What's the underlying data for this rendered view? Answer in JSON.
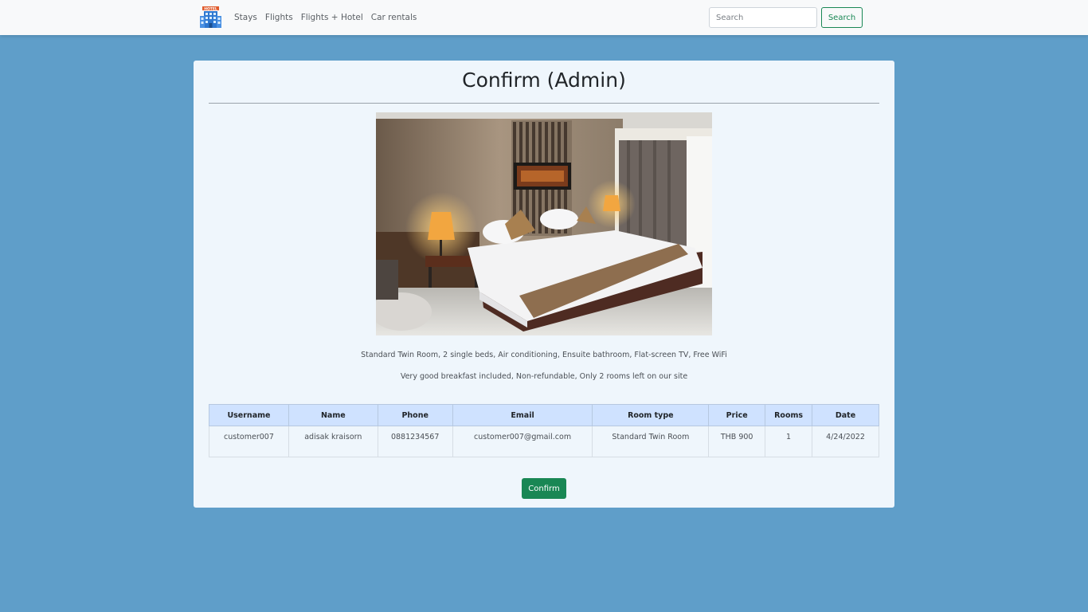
{
  "navbar": {
    "logo_icon": "hotel-building-icon",
    "logo_text": "HOTEL",
    "links": [
      "Stays",
      "Flights",
      "Flights + Hotel",
      "Car rentals"
    ],
    "search_placeholder": "Search",
    "search_button": "Search"
  },
  "page": {
    "title": "Confirm (Admin)",
    "photo_icon": "hotel-room-photo",
    "description_line1": "Standard Twin Room, 2 single beds, Air conditioning, Ensuite bathroom, Flat-screen TV, Free WiFi",
    "description_line2": "Very good breakfast included, Non-refundable, Only 2 rooms left on our site"
  },
  "table": {
    "headers": [
      "Username",
      "Name",
      "Phone",
      "Email",
      "Room type",
      "Price",
      "Rooms",
      "Date"
    ],
    "rows": [
      [
        "customer007",
        "adisak kraisorn",
        "0881234567",
        "customer007@gmail.com",
        "Standard Twin Room",
        "THB 900",
        "1",
        "4/24/2022"
      ]
    ]
  },
  "actions": {
    "confirm_label": "Confirm"
  },
  "colors": {
    "background": "#5f9ec9",
    "card": "#eff6fc",
    "table_header": "#cfe2ff",
    "success": "#198754"
  }
}
